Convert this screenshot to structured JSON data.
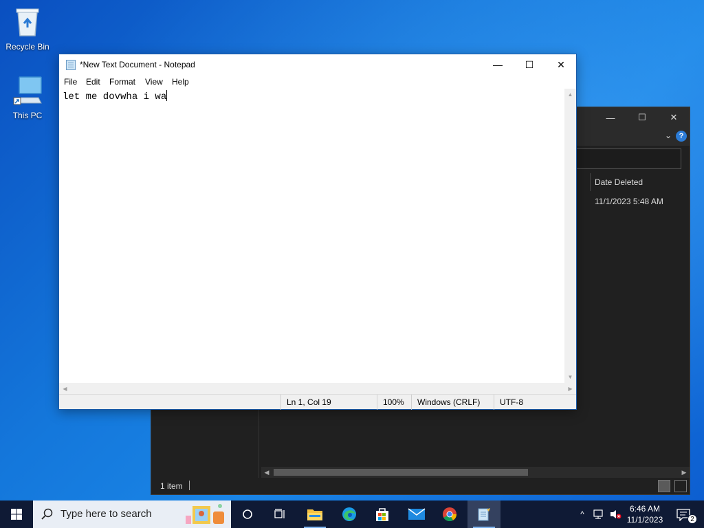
{
  "desktop": {
    "icons": [
      {
        "label": "Recycle Bin"
      },
      {
        "label": "This PC"
      }
    ]
  },
  "explorer": {
    "column_header": "Date Deleted",
    "rows": [
      {
        "date_deleted": "11/1/2023 5:48 AM"
      }
    ],
    "status_count": "1 item"
  },
  "notepad": {
    "title": "*New Text Document - Notepad",
    "menu": [
      "File",
      "Edit",
      "Format",
      "View",
      "Help"
    ],
    "content": "let me dovwha i wa",
    "status": {
      "position": "Ln 1, Col 19",
      "zoom": "100%",
      "line_ending": "Windows (CRLF)",
      "encoding": "UTF-8"
    }
  },
  "taskbar": {
    "search_placeholder": "Type here to search",
    "apps": [
      "task-view",
      "file-explorer",
      "edge",
      "microsoft-store",
      "mail",
      "chrome",
      "notepad"
    ],
    "clock": {
      "time": "6:46 AM",
      "date": "11/1/2023"
    },
    "notification_count": "2"
  },
  "colors": {
    "desktop_accent": "#1477db",
    "taskbar": "#0f1a35",
    "explorer_dark": "#202020"
  }
}
